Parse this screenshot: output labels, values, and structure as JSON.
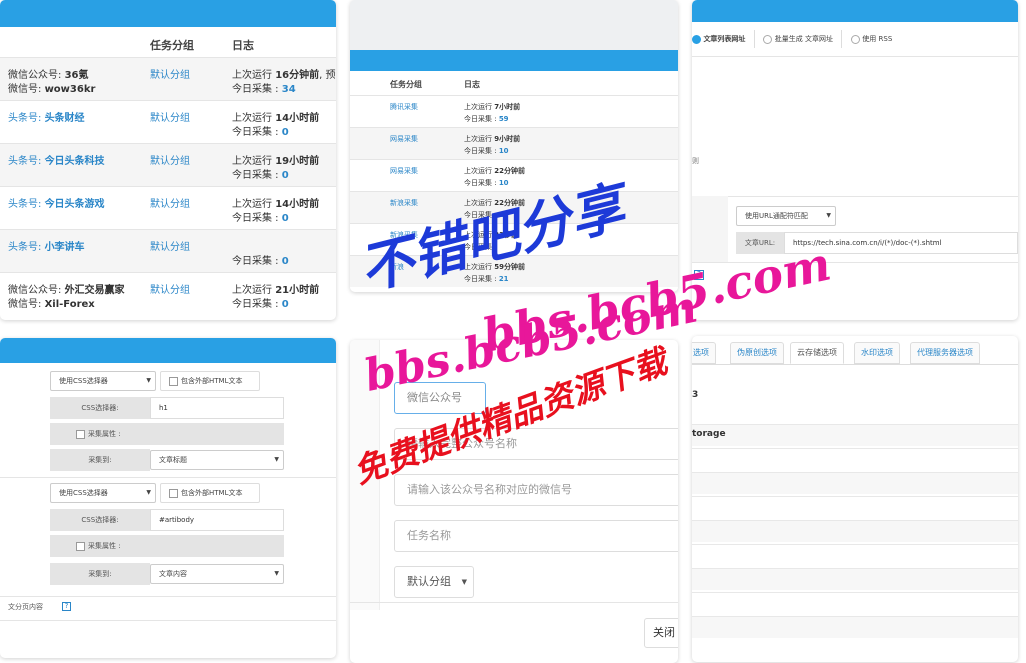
{
  "accounts_panel": {
    "col_group": "任务分组",
    "col_log": "日志",
    "rows": [
      {
        "line1_prefix": "微信公众号: ",
        "line1_name": "36氪",
        "line2_prefix": "微信号: ",
        "line2_name": "wow36kr",
        "group": "默认分组",
        "log1_prefix": "上次运行 ",
        "log1_value": "16分钟前",
        "log1_suffix": ", 预计",
        "log2_prefix": "今日采集 : ",
        "log2_value": "34"
      },
      {
        "line1_prefix": "头条号: ",
        "line1_name": "头条财经",
        "group": "默认分组",
        "log1_prefix": "上次运行 ",
        "log1_value": "14小时前",
        "log2_prefix": "今日采集 : ",
        "log2_value": "0"
      },
      {
        "line1_prefix": "头条号: ",
        "line1_name": "今日头条科技",
        "group": "默认分组",
        "log1_prefix": "上次运行 ",
        "log1_value": "19小时前",
        "log2_prefix": "今日采集 : ",
        "log2_value": "0"
      },
      {
        "line1_prefix": "头条号: ",
        "line1_name": "今日头条游戏",
        "group": "默认分组",
        "log1_prefix": "上次运行 ",
        "log1_value": "14小时前",
        "log2_prefix": "今日采集 : ",
        "log2_value": "0"
      },
      {
        "line1_prefix": "头条号: ",
        "line1_name": "小李讲车",
        "group": "默认分组",
        "log2_prefix": "今日采集 : ",
        "log2_value": "0"
      },
      {
        "line1_prefix": "微信公众号: ",
        "line1_name": "外汇交易赢家",
        "line2_prefix": "微信号: ",
        "line2_name": "Xil-Forex",
        "group": "默认分组",
        "log1_prefix": "上次运行 ",
        "log1_value": "21小时前",
        "log2_prefix": "今日采集 : ",
        "log2_value": "0"
      }
    ]
  },
  "tasks_panel": {
    "col_group": "任务分组",
    "col_log": "日志",
    "rows": [
      {
        "group": "腾讯采集",
        "log1_prefix": "上次运行 ",
        "log1_value": "7小时前",
        "log2_prefix": "今日采集 : ",
        "log2_value": "59"
      },
      {
        "group": "网易采集",
        "log1_prefix": "上次运行 ",
        "log1_value": "9小时前",
        "log2_prefix": "今日采集 : ",
        "log2_value": "10"
      },
      {
        "group": "网易采集",
        "log1_prefix": "上次运行 ",
        "log1_value": "22分钟前",
        "log2_prefix": "今日采集 : ",
        "log2_value": "10"
      },
      {
        "group": "新浪采集",
        "log1_prefix": "上次运行 ",
        "log1_value": "22分钟前",
        "log2_prefix": "今日采集 : ",
        "log2_value": "2"
      },
      {
        "group": "新浪采集",
        "log1_prefix": "上次运行 ",
        "log1_value": "33秒前",
        "log2_prefix": "今日采集 : ",
        "log2_value": ""
      },
      {
        "group": "新浪",
        "log1_prefix": "上次运行 ",
        "log1_value": "59分钟前",
        "log2_prefix": "今日采集 : ",
        "log2_value": "21"
      }
    ]
  },
  "url_panel": {
    "radio1": "文章列表网址",
    "radio2": "批量生成 文章网址",
    "radio3": "使用 RSS",
    "side_char": "则",
    "match_select": "使用URL通配符匹配",
    "url_label": "文章URL:",
    "url_value": "https://tech.sina.com.cn/i/(*)/doc-(*).shtml",
    "help_icon": "?"
  },
  "selector_panel": {
    "group1": {
      "mode": "使用CSS选择器",
      "include_html": "包含外部HTML文本",
      "selector_label": "CSS选择器:",
      "selector_value": "h1",
      "attr_label": "采集属性 :",
      "target_label": "采集到:",
      "target_value": "文章标题"
    },
    "group2": {
      "mode": "使用CSS选择器",
      "include_html": "包含外部HTML文本",
      "selector_label": "CSS选择器:",
      "selector_value": "#artibody",
      "attr_label": "采集属性 :",
      "target_label": "采集到:",
      "target_value": "文章内容"
    },
    "footer_label": "文分页内容",
    "help_icon": "?"
  },
  "form_panel": {
    "field1": "微信公众号",
    "field2": "请输入完整公众号名称",
    "field3": "请输入该公众号名称对应的微信号",
    "field4": "任务名称",
    "group_select": "默认分组",
    "close_button": "关闭"
  },
  "options_panel": {
    "tabs": [
      "选项",
      "伪原创选项",
      "云存储选项",
      "水印选项",
      "代理服务器选项"
    ],
    "row1": "3",
    "row2": "torage"
  },
  "watermark": {
    "line1": "不错吧分享",
    "line2": "bbs.bcb5.com",
    "line3": "bbs.bcb5.com",
    "line4": "免费提供精品资源下载"
  },
  "colors": {
    "accent_bar": "#29a0e4",
    "link": "#2a86c8",
    "watermark_blue": "#1d3ad8",
    "watermark_pink": "#e8179a",
    "watermark_red": "#e8101e"
  }
}
